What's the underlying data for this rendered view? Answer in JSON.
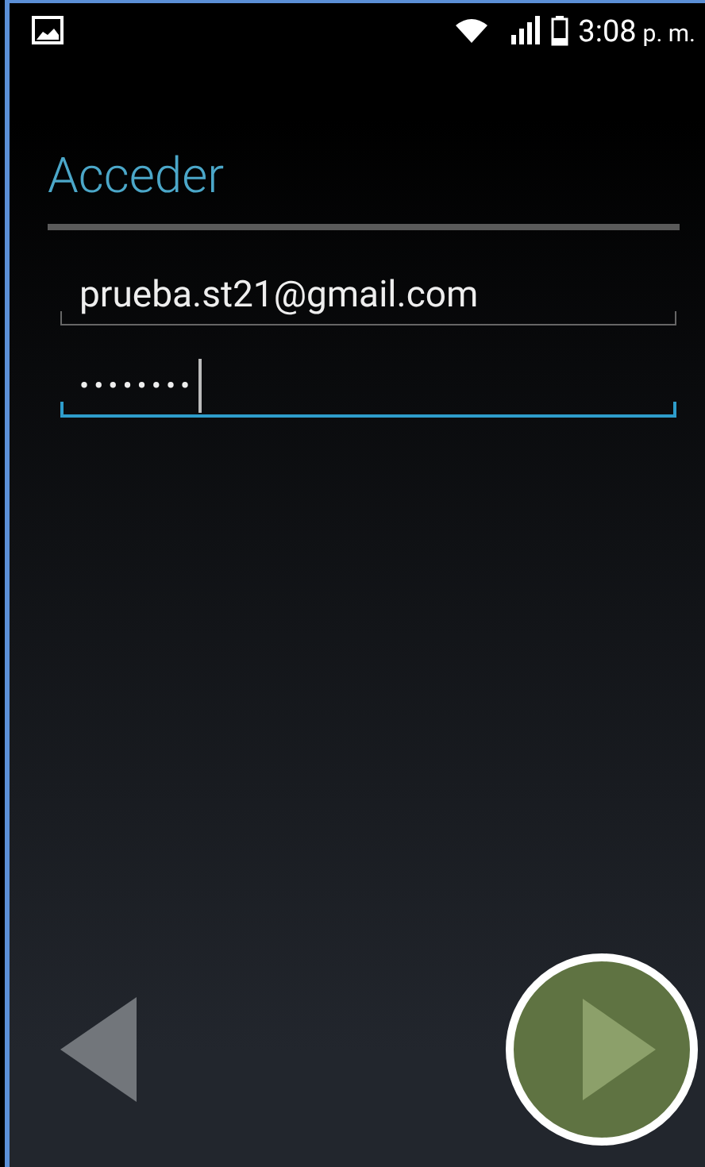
{
  "status_bar": {
    "time": "3:08",
    "period": "p. m."
  },
  "title": "Acceder",
  "fields": [
    {
      "kind": "email",
      "value": "prueba.st21@gmail.com",
      "focused": false
    },
    {
      "kind": "password",
      "value": "••••••••",
      "focused": true
    }
  ],
  "navigation": {
    "back_disabled": true,
    "next_highlighted": true
  }
}
